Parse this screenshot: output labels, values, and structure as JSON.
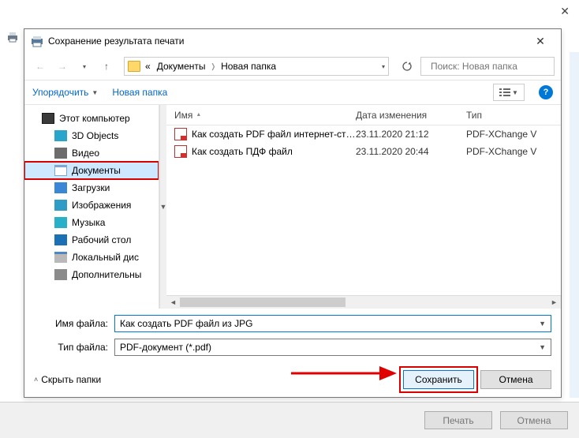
{
  "outer": {
    "print_label": "Печать",
    "cancel_label": "Отмена"
  },
  "dialog": {
    "title": "Сохранение результата печати",
    "breadcrumb": {
      "root_glyph": "«",
      "level1": "Документы",
      "level2": "Новая папка"
    },
    "search_placeholder": "Поиск: Новая папка",
    "toolbar": {
      "organize": "Упорядочить",
      "new_folder": "Новая папка",
      "help": "?"
    },
    "tree": [
      {
        "label": "Этот компьютер",
        "icon": "pc",
        "indent": false
      },
      {
        "label": "3D Objects",
        "icon": "cube",
        "indent": true
      },
      {
        "label": "Видео",
        "icon": "video",
        "indent": true
      },
      {
        "label": "Документы",
        "icon": "docs",
        "indent": true,
        "selected": true,
        "highlighted": true
      },
      {
        "label": "Загрузки",
        "icon": "dl",
        "indent": true
      },
      {
        "label": "Изображения",
        "icon": "img",
        "indent": true
      },
      {
        "label": "Музыка",
        "icon": "music",
        "indent": true
      },
      {
        "label": "Рабочий стол",
        "icon": "desk",
        "indent": true
      },
      {
        "label": "Локальный дис",
        "icon": "disk",
        "indent": true
      },
      {
        "label": "Дополнительны",
        "icon": "ext",
        "indent": true
      }
    ],
    "columns": {
      "name": "Имя",
      "date": "Дата изменения",
      "type": "Тип"
    },
    "files": [
      {
        "name": "Как создать PDF файл интернет-страни...",
        "date": "23.11.2020 21:12",
        "type": "PDF-XChange V"
      },
      {
        "name": "Как создать ПДФ файл",
        "date": "23.11.2020 20:44",
        "type": "PDF-XChange V"
      }
    ],
    "filename_label": "Имя файла:",
    "filename_value": "Как создать PDF файл из JPG",
    "filetype_label": "Тип файла:",
    "filetype_value": "PDF-документ (*.pdf)",
    "hide_folders": "Скрыть папки",
    "save": "Сохранить",
    "cancel": "Отмена"
  }
}
